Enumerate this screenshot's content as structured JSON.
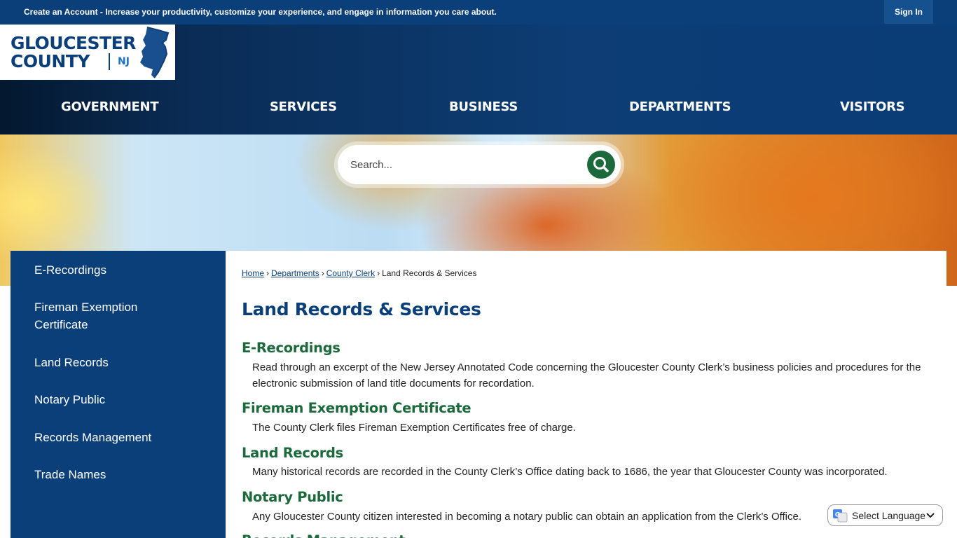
{
  "topbar": {
    "create_account": "Create an Account",
    "message": " - Increase your productivity, customize your experience, and engage in information you care about.",
    "sign_in": "Sign In"
  },
  "logo": {
    "line1": "GLOUCESTER",
    "line2": "COUNTY",
    "state": "NJ"
  },
  "nav": {
    "items": [
      "GOVERNMENT",
      "SERVICES",
      "BUSINESS",
      "DEPARTMENTS",
      "VISITORS"
    ]
  },
  "search": {
    "placeholder": "Search..."
  },
  "sidebar": {
    "items": [
      "E-Recordings",
      "Fireman Exemption Certificate",
      "Land Records",
      "Notary Public",
      "Records Management",
      "Trade Names"
    ]
  },
  "breadcrumb": {
    "home": "Home",
    "departments": "Departments",
    "county_clerk": "County Clerk",
    "current": "Land Records & Services",
    "separator": "›"
  },
  "main": {
    "title": "Land Records & Services",
    "sections": [
      {
        "title": "E-Recordings",
        "desc": "Read through an excerpt of the New Jersey Annotated Code concerning the Gloucester County Clerk’s business policies and procedures for the electronic submission of land title documents for recordation."
      },
      {
        "title": "Fireman Exemption Certificate",
        "desc": "The County Clerk files Fireman Exemption Certificates free of charge."
      },
      {
        "title": "Land Records",
        "desc": "Many historical records are recorded in the County Clerk’s Office dating back to 1686, the year that Gloucester County was incorporated."
      },
      {
        "title": "Notary Public",
        "desc": "Any Gloucester County citizen interested in becoming a notary public can obtain an application from the Clerk’s Office."
      },
      {
        "title": "Records Management",
        "desc": ""
      }
    ]
  },
  "translate": {
    "label": "Select Language"
  },
  "colors": {
    "primary_blue": "#0b3f7a",
    "accent_green": "#1c6a3b"
  }
}
